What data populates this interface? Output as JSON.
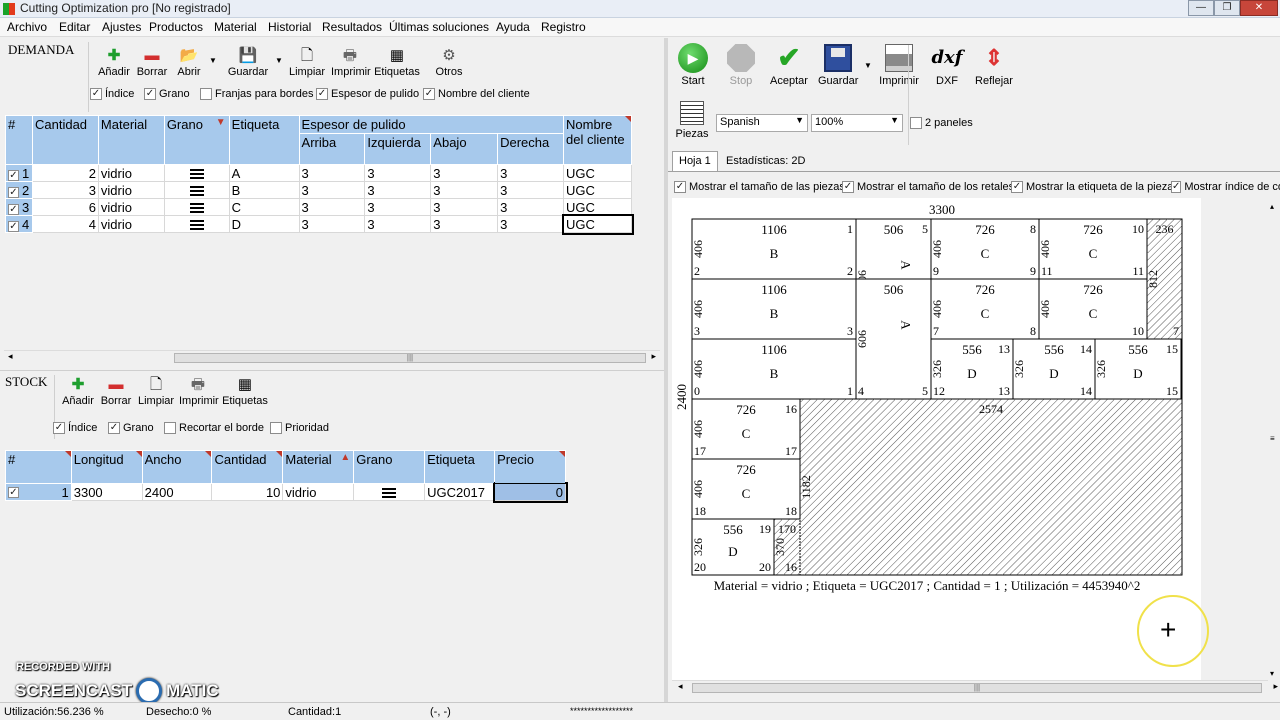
{
  "window": {
    "title": "Cutting Optimization pro [No registrado]",
    "min": "—",
    "max": "❐",
    "close": "✕"
  },
  "menu": [
    "Archivo",
    "Editar",
    "Ajustes",
    "Productos",
    "Material",
    "Historial",
    "Resultados",
    "Últimas soluciones",
    "Ayuda",
    "Registro"
  ],
  "demanda": {
    "label": "DEMANDA",
    "toolbar": [
      "Añadir",
      "Borrar",
      "Abrir",
      "Guardar",
      "Limpiar",
      "Imprimir",
      "Etiquetas",
      "Otros"
    ],
    "options": [
      "Índice",
      "Grano",
      "Franjas para bordes",
      "Espesor de pulido",
      "Nombre del cliente"
    ],
    "columns": {
      "idx": "#",
      "cantidad": "Cantidad",
      "material": "Material",
      "grano": "Grano",
      "etiqueta": "Etiqueta",
      "espesor": "Espesor de pulido",
      "arriba": "Arriba",
      "izquierda": "Izquierda",
      "abajo": "Abajo",
      "derecha": "Derecha",
      "cliente": "Nombre del cliente"
    },
    "rows": [
      {
        "idx": "1",
        "cantidad": "2",
        "material": "vidrio",
        "etiqueta": "A",
        "arriba": "3",
        "izquierda": "3",
        "abajo": "3",
        "derecha": "3",
        "cliente": "UGC"
      },
      {
        "idx": "2",
        "cantidad": "3",
        "material": "vidrio",
        "etiqueta": "B",
        "arriba": "3",
        "izquierda": "3",
        "abajo": "3",
        "derecha": "3",
        "cliente": "UGC"
      },
      {
        "idx": "3",
        "cantidad": "6",
        "material": "vidrio",
        "etiqueta": "C",
        "arriba": "3",
        "izquierda": "3",
        "abajo": "3",
        "derecha": "3",
        "cliente": "UGC"
      },
      {
        "idx": "4",
        "cantidad": "4",
        "material": "vidrio",
        "etiqueta": "D",
        "arriba": "3",
        "izquierda": "3",
        "abajo": "3",
        "derecha": "3",
        "cliente": "UGC"
      }
    ]
  },
  "stock": {
    "label": "STOCK",
    "toolbar": [
      "Añadir",
      "Borrar",
      "Limpiar",
      "Imprimir",
      "Etiquetas"
    ],
    "options": [
      "Índice",
      "Grano",
      "Recortar el borde",
      "Prioridad"
    ],
    "columns": {
      "idx": "#",
      "longitud": "Longitud",
      "ancho": "Ancho",
      "cantidad": "Cantidad",
      "material": "Material",
      "grano": "Grano",
      "etiqueta": "Etiqueta",
      "precio": "Precio"
    },
    "rows": [
      {
        "idx": "1",
        "longitud": "3300",
        "ancho": "2400",
        "cantidad": "10",
        "material": "vidrio",
        "etiqueta": "UGC2017",
        "precio": "0"
      }
    ]
  },
  "right": {
    "toolbar": [
      "Start",
      "Stop",
      "Aceptar",
      "Guardar",
      "Imprimir",
      "DXF",
      "Reflejar"
    ],
    "dxf_glyph": "dxf",
    "piezas": "Piezas",
    "language": "Spanish",
    "zoom": "100%",
    "dos_paneles": "2 paneles",
    "tabs": [
      "Hoja 1",
      "Estadísticas: 2D"
    ],
    "options": [
      "Mostrar el tamaño de las piezas",
      "Mostrar el tamaño de los retales",
      "Mostrar la etiqueta de la pieza",
      "Mostrar índice de co"
    ]
  },
  "sheet": {
    "width_label": "3300",
    "height_label": "2400",
    "caption": "Material = vidrio ; Etiqueta = UGC2017 ; Cantidad = 1 ; Utilización = 4453940^2",
    "pieces": [
      {
        "w": "1106",
        "h": "406",
        "lab": "B",
        "i1": "1",
        "i2": "2",
        "i3": "2"
      },
      {
        "w": "506",
        "h": "606",
        "lab": "A",
        "i1": "5",
        "i2": "",
        "i3": "6"
      },
      {
        "w": "726",
        "h": "406",
        "lab": "C",
        "i1": "8",
        "i2": "9",
        "i3": "9"
      },
      {
        "w": "726",
        "h": "406",
        "lab": "C",
        "i1": "10",
        "i2": "11",
        "i3": "11"
      },
      {
        "w": "1106",
        "h": "406",
        "lab": "B",
        "i1": "",
        "i2": "3",
        "i3": "3"
      },
      {
        "w": "506",
        "h": "606",
        "lab": "A",
        "i1": "",
        "i2": "4",
        "i3": "5"
      },
      {
        "w": "726",
        "h": "406",
        "lab": "C",
        "i1": "",
        "i2": "7",
        "i3": "8"
      },
      {
        "w": "726",
        "h": "406",
        "lab": "C",
        "i1": "",
        "i2": "",
        "i3": "10"
      },
      {
        "w": "1106",
        "h": "406",
        "lab": "B",
        "i1": "",
        "i2": "0",
        "i3": "1"
      },
      {
        "w": "556",
        "h": "326",
        "lab": "D",
        "i1": "13",
        "i2": "12",
        "i3": "13"
      },
      {
        "w": "556",
        "h": "326",
        "lab": "D",
        "i1": "14",
        "i2": "",
        "i3": "14"
      },
      {
        "w": "556",
        "h": "326",
        "lab": "D",
        "i1": "15",
        "i2": "",
        "i3": "15"
      },
      {
        "w": "726",
        "h": "406",
        "lab": "C",
        "i1": "16",
        "i2": "17",
        "i3": "17"
      },
      {
        "w": "726",
        "h": "406",
        "lab": "C",
        "i1": "",
        "i2": "18",
        "i3": "18"
      },
      {
        "w": "556",
        "h": "326",
        "lab": "D",
        "i1": "19",
        "i2": "20",
        "i3": "20"
      }
    ],
    "waste": [
      {
        "w": "236",
        "h": "812",
        "i": "7"
      },
      {
        "w": "2574",
        "h": "1182",
        "i": ""
      },
      {
        "w": "170",
        "h": "370",
        "i": "16"
      }
    ]
  },
  "status": {
    "util": "Utilización:56.236 %",
    "desecho": "Desecho:0 %",
    "cantidad": "Cantidad:1",
    "coords": "(-, -)",
    "stars": "******************"
  },
  "watermark": {
    "line1": "RECORDED WITH",
    "line2a": "SCREENCAST",
    "line2b": "MATIC"
  }
}
